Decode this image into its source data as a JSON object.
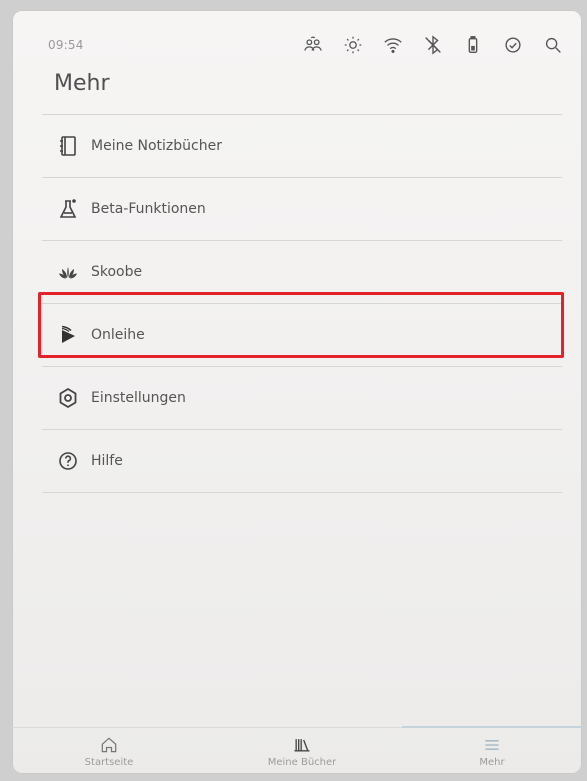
{
  "status_bar": {
    "time": "09:54",
    "icons": [
      "sync-person-icon",
      "brightness-icon",
      "wifi-icon",
      "bluetooth-off-icon",
      "battery-icon",
      "sync-icon",
      "search-icon"
    ]
  },
  "page": {
    "title": "Mehr"
  },
  "menu": {
    "items": [
      {
        "label": "Meine Notizbücher",
        "icon": "notebook-icon"
      },
      {
        "label": "Beta-Funktionen",
        "icon": "flask-icon"
      },
      {
        "label": "Skoobe",
        "icon": "skoobe-icon"
      },
      {
        "label": "Onleihe",
        "icon": "onleihe-icon",
        "highlighted": true
      },
      {
        "label": "Einstellungen",
        "icon": "gear-icon"
      },
      {
        "label": "Hilfe",
        "icon": "help-icon"
      }
    ]
  },
  "bottom_nav": {
    "items": [
      {
        "label": "Startseite",
        "icon": "home-icon"
      },
      {
        "label": "Meine Bücher",
        "icon": "books-icon"
      },
      {
        "label": "Mehr",
        "icon": "menu-icon",
        "active": true
      }
    ]
  },
  "colors": {
    "highlight": "#e32229",
    "active_tab": "#c4d3dc"
  }
}
